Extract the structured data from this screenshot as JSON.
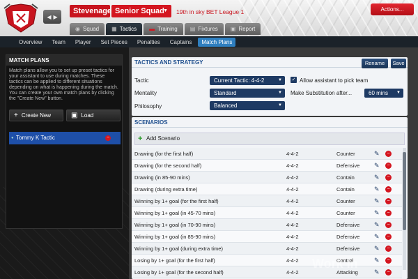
{
  "header": {
    "team_name": "Stevenage",
    "squad": "Senior Squad",
    "league_position": "19th in sky BET League 1",
    "actions_label": "Actions..."
  },
  "tabs": [
    {
      "label": "Squad",
      "icon": "squad-icon"
    },
    {
      "label": "Tactics",
      "icon": "tactics-icon",
      "active": true
    },
    {
      "label": "Training",
      "icon": "training-icon"
    },
    {
      "label": "Fixtures",
      "icon": "fixtures-icon"
    },
    {
      "label": "Report",
      "icon": "report-icon"
    }
  ],
  "subnav": [
    "Overview",
    "Team",
    "Player",
    "Set Pieces",
    "Penalties",
    "Captains",
    "Match Plans"
  ],
  "match_plans": {
    "title": "MATCH PLANS",
    "description": "Match plans allow you to set up preset tactics for your assistant to use during matches. These tactics can be applied to different situations depending on what is happening during the match. You can create your own match plans by clicking the \"Create New\" button.",
    "create_label": "Create New",
    "load_label": "Load",
    "plans": [
      "Tommy K Tactic"
    ]
  },
  "tactics": {
    "title": "TACTICS AND STRATEGY",
    "rename_label": "Rename",
    "save_label": "Save",
    "tactic_label": "Tactic",
    "tactic_value": "Current Tactic: 4-4-2",
    "mentality_label": "Mentality",
    "mentality_value": "Standard",
    "philosophy_label": "Philosophy",
    "philosophy_value": "Balanced",
    "assistant_label": "Allow assistant to pick team",
    "assistant_checked": true,
    "substitution_label": "Make Substitution after...",
    "substitution_value": "60 mins"
  },
  "scenarios": {
    "title": "SCENARIOS",
    "add_label": "Add Scenario",
    "rows": [
      {
        "name": "Drawing (for the first half)",
        "formation": "4-4-2",
        "mentality": "Counter"
      },
      {
        "name": "Drawing (for the second half)",
        "formation": "4-4-2",
        "mentality": "Defensive"
      },
      {
        "name": "Drawing (in 85-90 mins)",
        "formation": "4-4-2",
        "mentality": "Contain"
      },
      {
        "name": "Drawing (during extra time)",
        "formation": "4-4-2",
        "mentality": "Contain"
      },
      {
        "name": "Winning by 1+ goal (for the first half)",
        "formation": "4-4-2",
        "mentality": "Counter"
      },
      {
        "name": "Winning by 1+ goal (in 45-70 mins)",
        "formation": "4-4-2",
        "mentality": "Counter"
      },
      {
        "name": "Winning by 1+ goal (in 70-90 mins)",
        "formation": "4-4-2",
        "mentality": "Defensive"
      },
      {
        "name": "Winning by 1+ goal (in 85-90 mins)",
        "formation": "4-4-2",
        "mentality": "Defensive"
      },
      {
        "name": "Winning by 1+ goal (during extra time)",
        "formation": "4-4-2",
        "mentality": "Defensive"
      },
      {
        "name": "Losing by 1+ goal (for the first half)",
        "formation": "4-4-2",
        "mentality": "Control"
      },
      {
        "name": "Losing by 1+ goal (for the second half)",
        "formation": "4-4-2",
        "mentality": "Attacking"
      }
    ]
  },
  "watermark": "Work In",
  "colors": {
    "brand_red": "#d41620",
    "accent_blue": "#2f7fbf",
    "dark_navy": "#1e3a63"
  }
}
